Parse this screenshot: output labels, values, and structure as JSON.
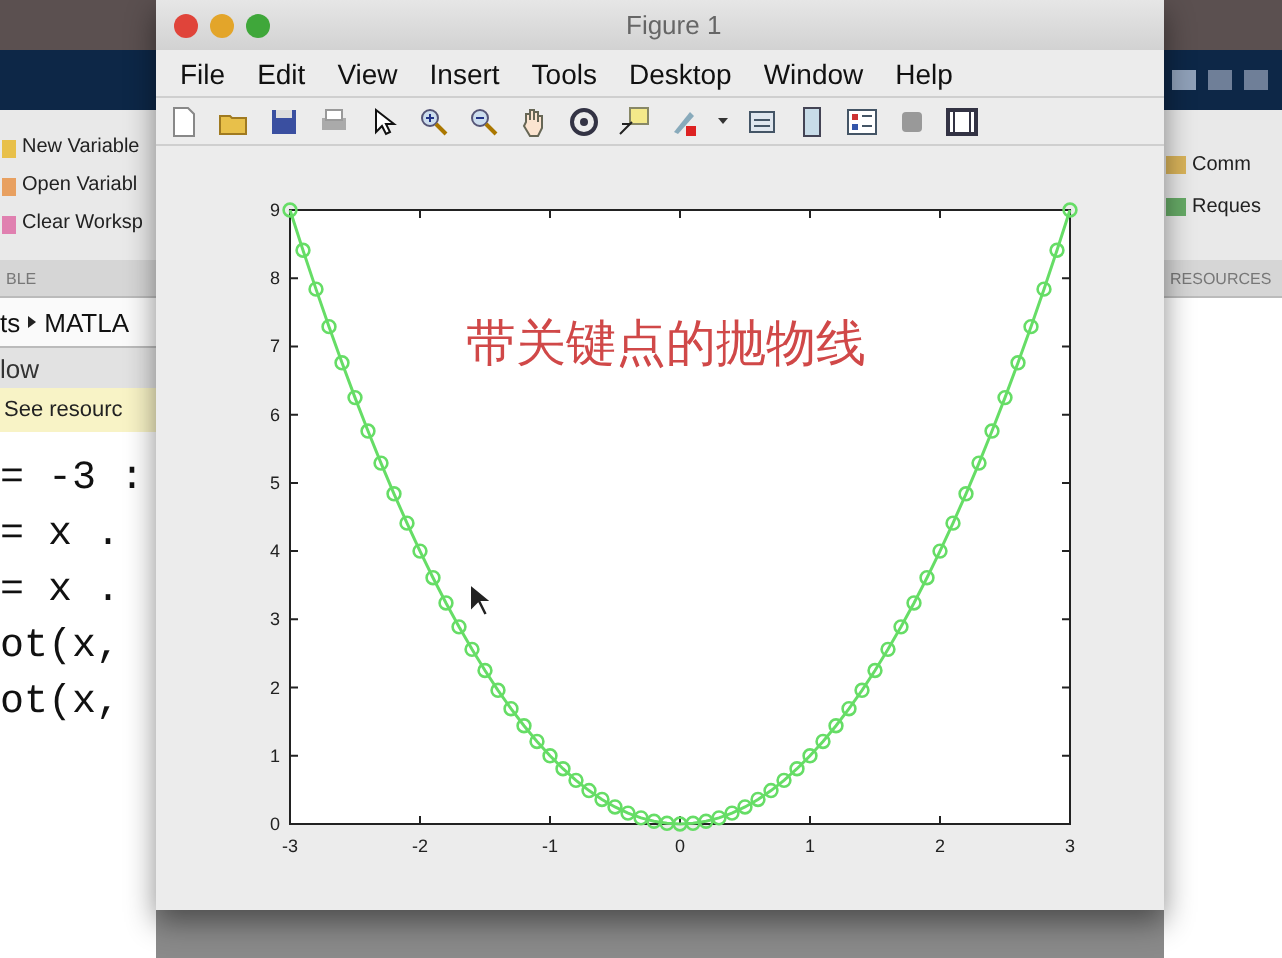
{
  "background_window": {
    "left_toolbar": {
      "buttons": [
        "New Variable",
        "Open Variabl",
        "Clear Worksp"
      ],
      "section_label": "BLE"
    },
    "path": [
      "ts",
      "MATLA"
    ],
    "panel_title": "low",
    "notice": "See resourc",
    "code_lines": [
      "= -3 :",
      "= x .",
      "= x .",
      "ot(x,",
      "ot(x,"
    ],
    "right_toolbar": {
      "buttons": [
        "Comm",
        "Reques"
      ],
      "section_label": "RESOURCES"
    }
  },
  "figure": {
    "title": "Figure 1",
    "menu": [
      "File",
      "Edit",
      "View",
      "Insert",
      "Tools",
      "Desktop",
      "Window",
      "Help"
    ],
    "chart_data": {
      "type": "line",
      "x": [
        -3,
        -2.9,
        -2.8,
        -2.7,
        -2.6,
        -2.5,
        -2.4,
        -2.3,
        -2.2,
        -2.1,
        -2,
        -1.9,
        -1.8,
        -1.7,
        -1.6,
        -1.5,
        -1.4,
        -1.3,
        -1.2,
        -1.1,
        -1,
        -0.9,
        -0.8,
        -0.7,
        -0.6,
        -0.5,
        -0.4,
        -0.3,
        -0.2,
        -0.1,
        0,
        0.1,
        0.2,
        0.3,
        0.4,
        0.5,
        0.6,
        0.7,
        0.8,
        0.9,
        1,
        1.1,
        1.2,
        1.3,
        1.4,
        1.5,
        1.6,
        1.7,
        1.8,
        1.9,
        2,
        2.1,
        2.2,
        2.3,
        2.4,
        2.5,
        2.6,
        2.7,
        2.8,
        2.9,
        3
      ],
      "series": [
        {
          "color": "#66dd66",
          "marker": "o",
          "values": [
            9,
            8.41,
            7.84,
            7.29,
            6.76,
            6.25,
            5.76,
            5.29,
            4.84,
            4.41,
            4,
            3.61,
            3.24,
            2.89,
            2.56,
            2.25,
            1.96,
            1.69,
            1.44,
            1.21,
            1,
            0.81,
            0.64,
            0.49,
            0.36,
            0.25,
            0.16,
            0.09,
            0.04,
            0.01,
            0,
            0.01,
            0.04,
            0.09,
            0.16,
            0.25,
            0.36,
            0.49,
            0.64,
            0.81,
            1,
            1.21,
            1.44,
            1.69,
            1.96,
            2.25,
            2.56,
            2.89,
            3.24,
            3.61,
            4,
            4.41,
            4.84,
            5.29,
            5.76,
            6.25,
            6.76,
            7.29,
            7.84,
            8.41,
            9
          ]
        }
      ],
      "xlim": [
        -3,
        3
      ],
      "ylim": [
        0,
        9
      ],
      "xticks": [
        -3,
        -2,
        -1,
        0,
        1,
        2,
        3
      ],
      "yticks": [
        0,
        1,
        2,
        3,
        4,
        5,
        6,
        7,
        8,
        9
      ],
      "annotations": [
        "带关键点的抛物线"
      ]
    }
  }
}
